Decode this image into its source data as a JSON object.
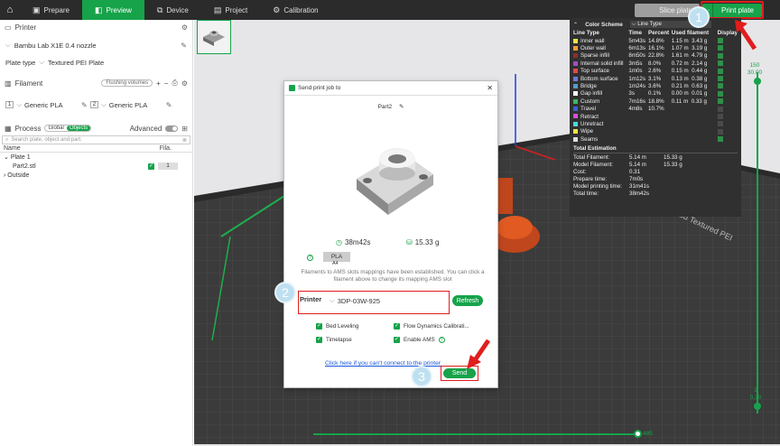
{
  "topbar": {
    "tabs": [
      {
        "label": "Prepare",
        "icon": "prepare-icon"
      },
      {
        "label": "Preview",
        "icon": "preview-icon",
        "active": true
      },
      {
        "label": "Device",
        "icon": "device-icon"
      },
      {
        "label": "Project",
        "icon": "project-icon"
      },
      {
        "label": "Calibration",
        "icon": "calibration-icon"
      }
    ],
    "slice_label": "Slice plate",
    "print_label": "Print plate"
  },
  "left": {
    "printer_heading": "Printer",
    "printer_name": "Bambu Lab X1E 0.4 nozzle",
    "plate_type_label": "Plate type",
    "plate_type_value": "Textured PEI Plate",
    "filament_heading": "Filament",
    "flushing_label": "Flushing volumes",
    "filaments": [
      {
        "slot": "1",
        "name": "Generic PLA"
      },
      {
        "slot": "2",
        "name": "Generic PLA"
      }
    ],
    "process_heading": "Process",
    "global_label": "Global",
    "objects_label": "Objects",
    "advanced_label": "Advanced",
    "search_placeholder": "Search plate, object and part.",
    "col_name": "Name",
    "col_fila": "Fila.",
    "plate_label": "Plate 1",
    "part_label": "Part2.stl",
    "part_fila": "1",
    "outside_label": "Outside"
  },
  "scheme": {
    "title": "Color Scheme",
    "selected": "Line Type",
    "headers": {
      "type": "Line Type",
      "time": "Time",
      "percent": "Percent",
      "usage": "Used filament",
      "display": "Display"
    },
    "rows": [
      {
        "name": "Inner wall",
        "color": "#f5e14a",
        "time": "5m43s",
        "pct": "14.8%",
        "len": "1.15 m",
        "g": "3.43 g",
        "on": true
      },
      {
        "name": "Outer wall",
        "color": "#f39c34",
        "time": "6m13s",
        "pct": "16.1%",
        "len": "1.07 m",
        "g": "3.19 g",
        "on": true
      },
      {
        "name": "Sparse infill",
        "color": "#8e2f2f",
        "time": "8m50s",
        "pct": "22.8%",
        "len": "1.61 m",
        "g": "4.79 g",
        "on": true
      },
      {
        "name": "Internal solid infill",
        "color": "#a04fc2",
        "time": "3m5s",
        "pct": "8.0%",
        "len": "0.72 m",
        "g": "2.14 g",
        "on": true
      },
      {
        "name": "Top surface",
        "color": "#e04a4a",
        "time": "1m0s",
        "pct": "2.6%",
        "len": "0.15 m",
        "g": "0.44 g",
        "on": true
      },
      {
        "name": "Bottom surface",
        "color": "#6c7bd6",
        "time": "1m12s",
        "pct": "3.1%",
        "len": "0.13 m",
        "g": "0.38 g",
        "on": true
      },
      {
        "name": "Bridge",
        "color": "#4ea0c8",
        "time": "1m24s",
        "pct": "3.6%",
        "len": "0.21 m",
        "g": "0.63 g",
        "on": true
      },
      {
        "name": "Gap infill",
        "color": "#ffffff",
        "time": "3s",
        "pct": "0.1%",
        "len": "0.00 m",
        "g": "0.01 g",
        "on": true
      },
      {
        "name": "Custom",
        "color": "#3fb55a",
        "time": "7m16s",
        "pct": "18.8%",
        "len": "0.11 m",
        "g": "0.33 g",
        "on": true
      },
      {
        "name": "Travel",
        "color": "#3a5fd0",
        "time": "4m8s",
        "pct": "10.7%",
        "len": "",
        "g": "",
        "on": false
      },
      {
        "name": "Retract",
        "color": "#d84fd8",
        "time": "",
        "pct": "",
        "len": "",
        "g": "",
        "on": false
      },
      {
        "name": "Unretract",
        "color": "#4fd8d8",
        "time": "",
        "pct": "",
        "len": "",
        "g": "",
        "on": false
      },
      {
        "name": "Wipe",
        "color": "#f5e14a",
        "time": "",
        "pct": "",
        "len": "",
        "g": "",
        "on": false
      },
      {
        "name": "Seams",
        "color": "#dddddd",
        "time": "",
        "pct": "",
        "len": "",
        "g": "",
        "on": true
      }
    ],
    "estimation_title": "Total Estimation",
    "estimation": [
      {
        "k": "Total Filament:",
        "v1": "5.14 m",
        "v2": "15.33 g"
      },
      {
        "k": "Model Filament:",
        "v1": "5.14 m",
        "v2": "15.33 g"
      },
      {
        "k": "Cost:",
        "v1": "0.31",
        "v2": ""
      },
      {
        "k": "Prepare time:",
        "v1": "7m0s",
        "v2": ""
      },
      {
        "k": "Model printing time:",
        "v1": "31m41s",
        "v2": ""
      },
      {
        "k": "Total time:",
        "v1": "38m42s",
        "v2": ""
      }
    ]
  },
  "dialog": {
    "title": "Send print job to",
    "part_name": "Part2",
    "time": "38m42s",
    "weight": "15.33 g",
    "filament": "PLA",
    "slot": "A4",
    "info": "Filaments to AMS slots mappings have been established. You can click a filament above to change its mapping AMS slot",
    "printer_label": "Printer",
    "printer_value": "3DP-03W-925",
    "refresh_label": "Refresh",
    "options": {
      "bed_leveling": "Bed Leveling",
      "flow_dynamics": "Flow Dynamics Calibrati...",
      "timelapse": "Timelapse",
      "enable_ams": "Enable AMS"
    },
    "link_text": "Click here if you can't connect to the printer",
    "send_label": "Send"
  },
  "steps": [
    "1",
    "2",
    "3"
  ],
  "layers": {
    "top_layer": "150",
    "top_height": "30.00",
    "bottom_layer": "1",
    "bottom_height": "0.20",
    "moves": "485"
  },
  "colors": {
    "accent": "#16a34a",
    "highlight": "#e11d1d"
  }
}
